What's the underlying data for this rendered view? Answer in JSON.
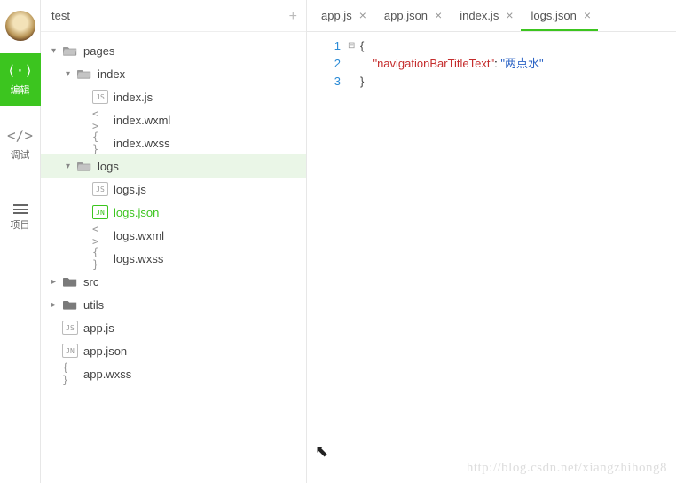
{
  "rail": {
    "edit": "编辑",
    "debug": "调试",
    "project": "项目"
  },
  "tree": {
    "header": "test",
    "nodes": [
      {
        "id": "pages",
        "label": "pages",
        "kind": "folder",
        "indent": 0,
        "caret": "down"
      },
      {
        "id": "index",
        "label": "index",
        "kind": "folder",
        "indent": 1,
        "caret": "down"
      },
      {
        "id": "index-js",
        "label": "index.js",
        "kind": "js",
        "indent": 2,
        "caret": "none"
      },
      {
        "id": "index-wxml",
        "label": "index.wxml",
        "kind": "angle",
        "indent": 2,
        "caret": "none"
      },
      {
        "id": "index-wxss",
        "label": "index.wxss",
        "kind": "curly",
        "indent": 2,
        "caret": "none"
      },
      {
        "id": "logs",
        "label": "logs",
        "kind": "folder",
        "indent": 1,
        "caret": "down",
        "selected": true
      },
      {
        "id": "logs-js",
        "label": "logs.js",
        "kind": "js",
        "indent": 2,
        "caret": "none"
      },
      {
        "id": "logs-json",
        "label": "logs.json",
        "kind": "json",
        "indent": 2,
        "caret": "none",
        "active": true
      },
      {
        "id": "logs-wxml",
        "label": "logs.wxml",
        "kind": "angle",
        "indent": 2,
        "caret": "none"
      },
      {
        "id": "logs-wxss",
        "label": "logs.wxss",
        "kind": "curly",
        "indent": 2,
        "caret": "none"
      },
      {
        "id": "src",
        "label": "src",
        "kind": "folder-closed",
        "indent": 0,
        "caret": "right"
      },
      {
        "id": "utils",
        "label": "utils",
        "kind": "folder-closed",
        "indent": 0,
        "caret": "right"
      },
      {
        "id": "app-js",
        "label": "app.js",
        "kind": "js",
        "indent": 0,
        "caret": "none"
      },
      {
        "id": "app-json",
        "label": "app.json",
        "kind": "json",
        "indent": 0,
        "caret": "none"
      },
      {
        "id": "app-wxss",
        "label": "app.wxss",
        "kind": "curly",
        "indent": 0,
        "caret": "none"
      }
    ]
  },
  "tabs": [
    {
      "id": "tab-app-js",
      "label": "app.js"
    },
    {
      "id": "tab-app-json",
      "label": "app.json"
    },
    {
      "id": "tab-index-js",
      "label": "index.js"
    },
    {
      "id": "tab-logs-json",
      "label": "logs.json",
      "active": true
    }
  ],
  "code": {
    "line_numbers": [
      "1",
      "2",
      "3"
    ],
    "l1": "{",
    "l2_key": "\"navigationBarTitleText\"",
    "l2_colon": ": ",
    "l2_val": "\"两点水\"",
    "l3": "}",
    "fold": "⊟"
  },
  "watermark": "http://blog.csdn.net/xiangzhihong8",
  "glyph": {
    "plus": "+",
    "close": "×",
    "caret_down": "▾",
    "caret_right": "▸"
  }
}
